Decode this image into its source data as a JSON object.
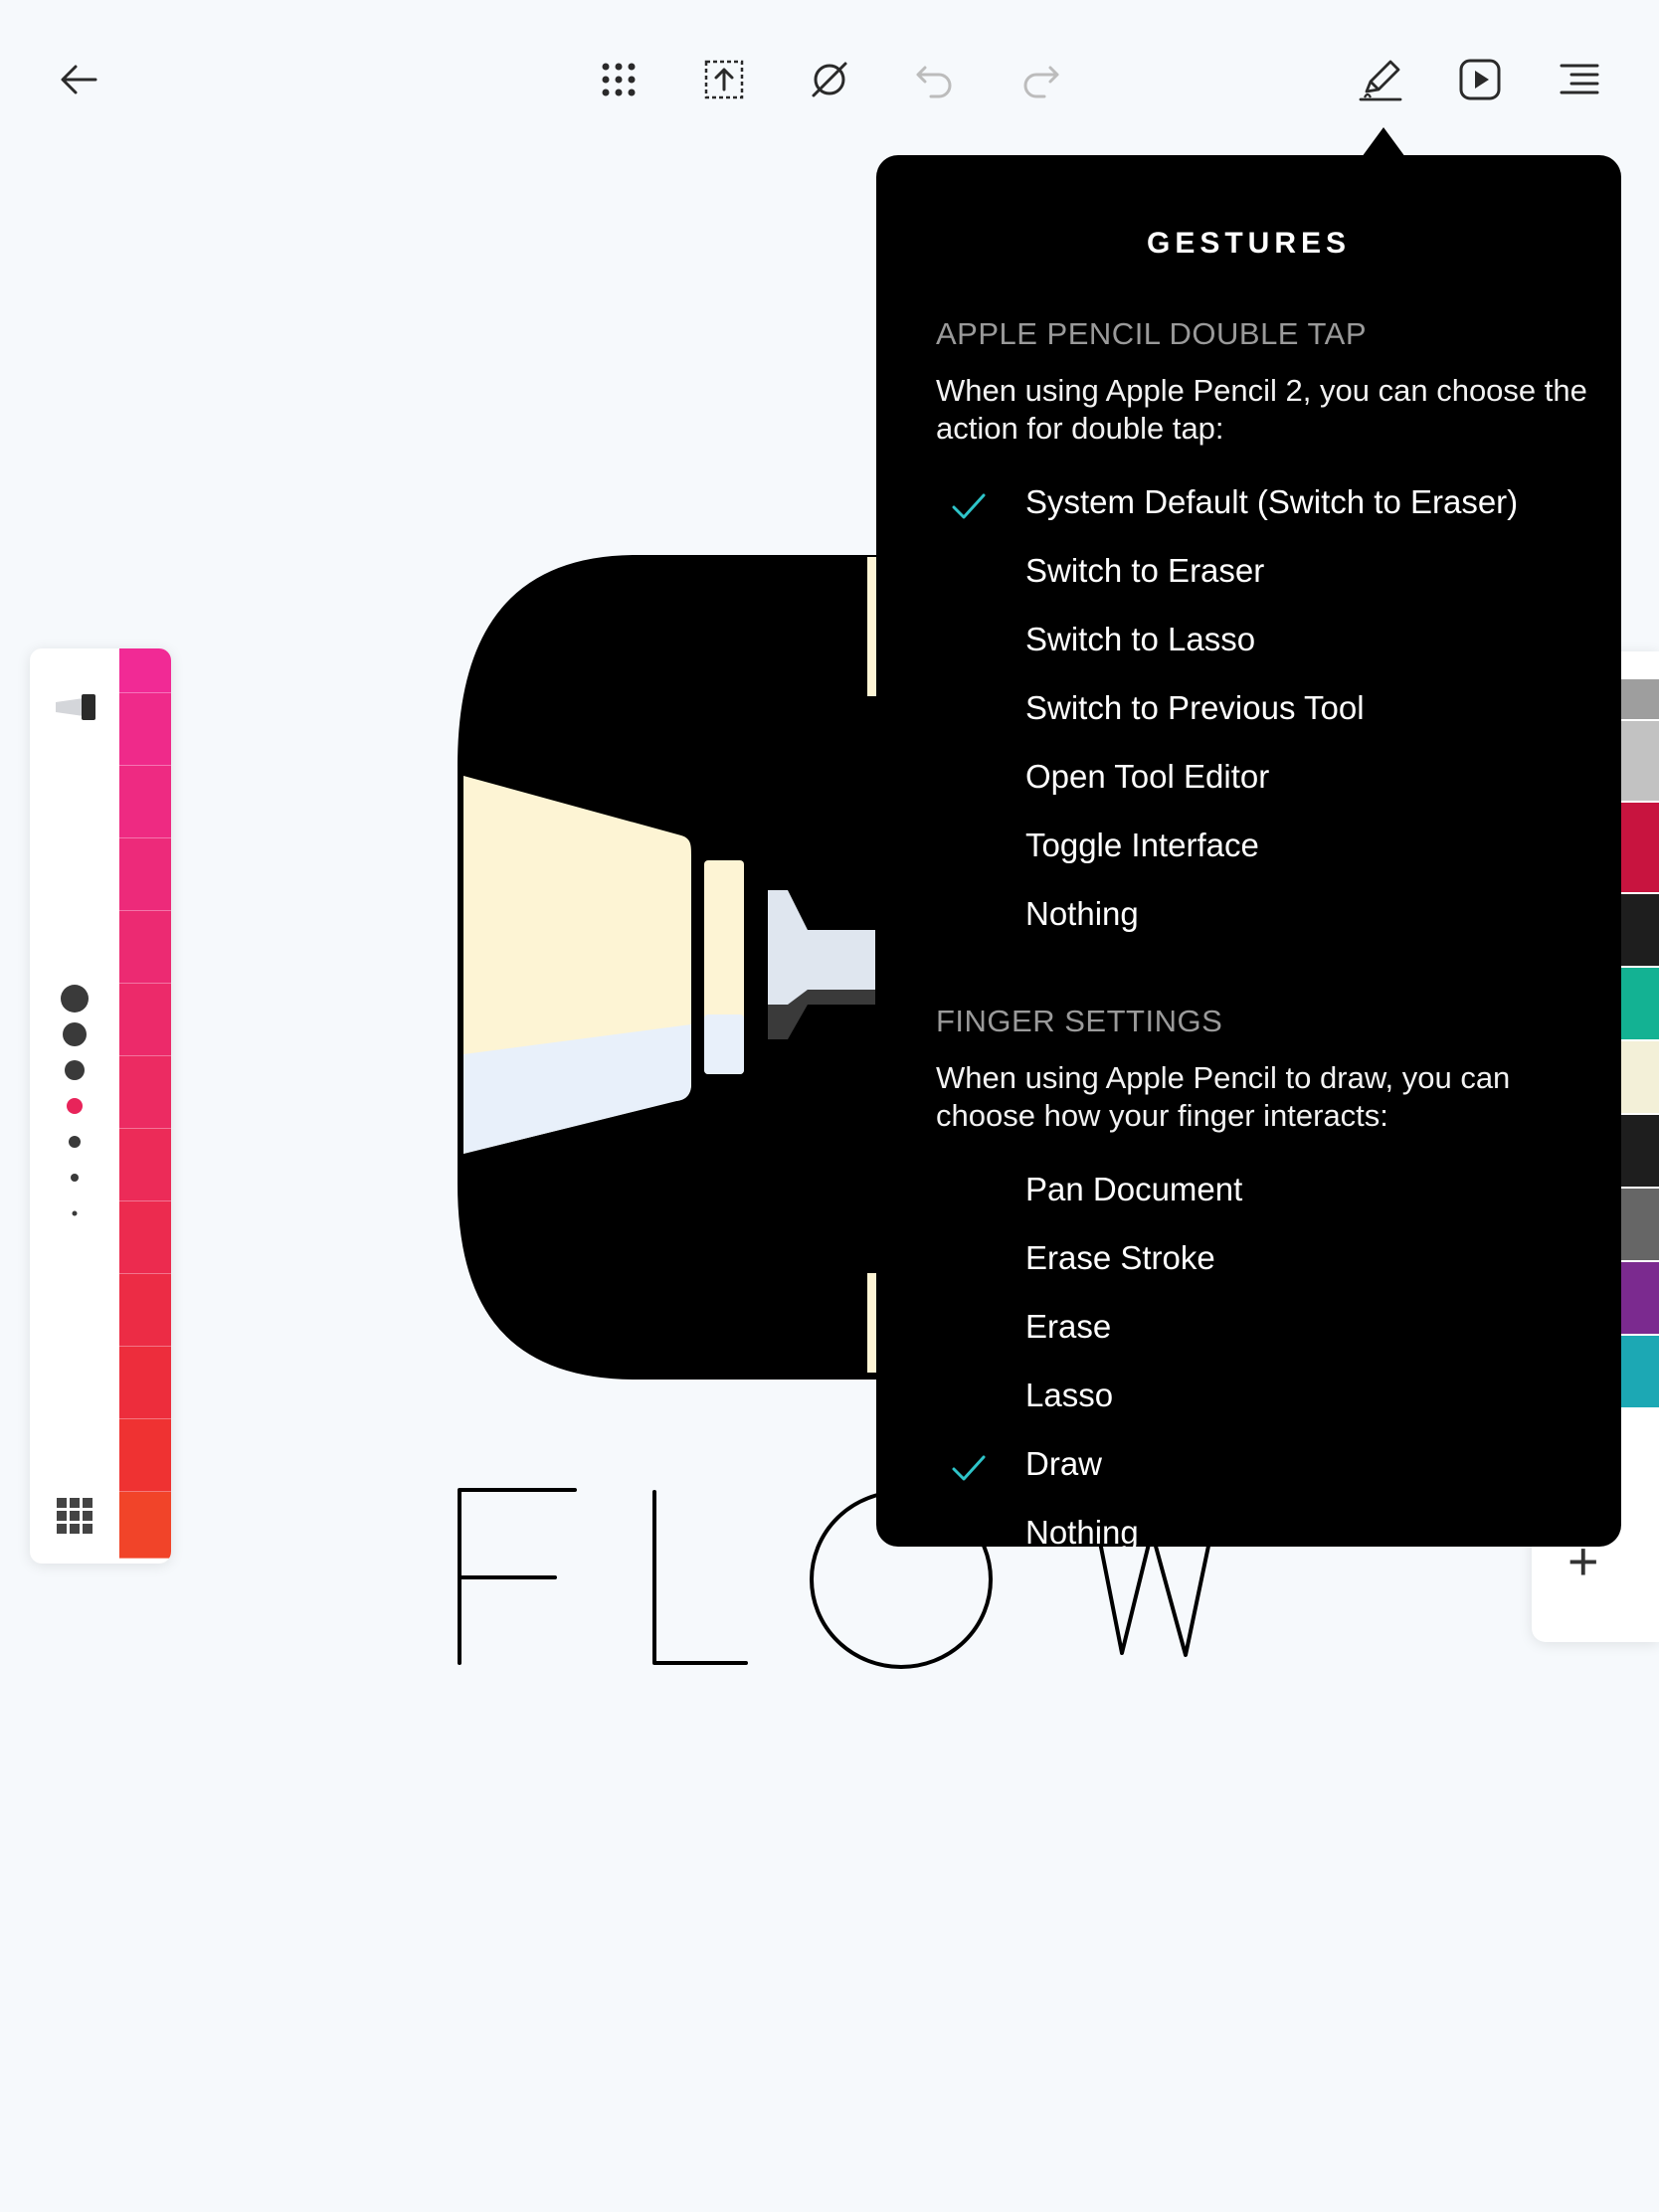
{
  "toolbar": {
    "back": "back-arrow-icon",
    "center": [
      "grid-dots-icon",
      "export-icon",
      "no-tool-icon",
      "undo-icon",
      "redo-icon"
    ],
    "right": [
      "pen-edit-icon",
      "play-icon",
      "menu-icon"
    ]
  },
  "canvas": {
    "word": "FLOW"
  },
  "palette": {
    "swatches": [
      "#f12a95",
      "#ef2a8a",
      "#ee2a82",
      "#ed2a7a",
      "#ec2a72",
      "#ec2a6a",
      "#ec2b62",
      "#ec2b58",
      "#ec2b4f",
      "#ec2c45",
      "#ed2d3c",
      "#ef3232",
      "#f14429"
    ],
    "accent_dot": "#e8245a"
  },
  "right_palette": {
    "swatches": [
      "#9e9e9e",
      "#c2c2c2",
      "#c8143f",
      "#1e1e1e",
      "#13b293",
      "#f3f0d8",
      "#1e1e1e",
      "#666666",
      "#7b2a8f",
      "#1ca8b4"
    ],
    "add_label": "+"
  },
  "popover": {
    "title": "GESTURES",
    "pencil_section": {
      "header": "APPLE PENCIL DOUBLE TAP",
      "description": "When using Apple Pencil 2, you can choose the action for double tap:",
      "options": [
        {
          "label": "System Default (Switch to Eraser)",
          "checked": true
        },
        {
          "label": "Switch to Eraser",
          "checked": false
        },
        {
          "label": "Switch to Lasso",
          "checked": false
        },
        {
          "label": "Switch to Previous Tool",
          "checked": false
        },
        {
          "label": "Open Tool Editor",
          "checked": false
        },
        {
          "label": "Toggle Interface",
          "checked": false
        },
        {
          "label": "Nothing",
          "checked": false
        }
      ]
    },
    "finger_section": {
      "header": "FINGER SETTINGS",
      "description": "When using Apple Pencil to draw, you can choose how your finger interacts:",
      "options": [
        {
          "label": "Pan Document",
          "checked": false
        },
        {
          "label": "Erase Stroke",
          "checked": false
        },
        {
          "label": "Erase",
          "checked": false
        },
        {
          "label": "Lasso",
          "checked": false
        },
        {
          "label": "Draw",
          "checked": true
        },
        {
          "label": "Nothing",
          "checked": false
        }
      ]
    },
    "check_color": "#2ec4c9"
  }
}
